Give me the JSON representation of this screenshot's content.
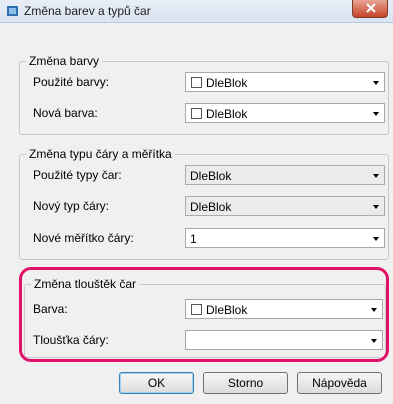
{
  "window": {
    "title": "Změna barev a typů čar"
  },
  "color_group": {
    "legend": "Změna barvy",
    "used_label": "Použité barvy:",
    "used_value": "DleBlok",
    "new_label": "Nová barva:",
    "new_value": "DleBlok"
  },
  "linetype_group": {
    "legend": "Změna typu čáry a měřítka",
    "used_label": "Použité typy čar:",
    "used_value": "DleBlok",
    "new_label": "Nový typ čáry:",
    "new_value": "DleBlok",
    "scale_label": "Nové měřítko čáry:",
    "scale_value": "1"
  },
  "thickness_group": {
    "legend": "Změna tlouštěk čar",
    "color_label": "Barva:",
    "color_value": "DleBlok",
    "thickness_label": "Tloušťka čáry:",
    "thickness_value": ""
  },
  "buttons": {
    "ok": "OK",
    "cancel": "Storno",
    "help": "Nápověda"
  },
  "colors": {
    "highlight": "#e0136b",
    "close": "#c8432b"
  }
}
